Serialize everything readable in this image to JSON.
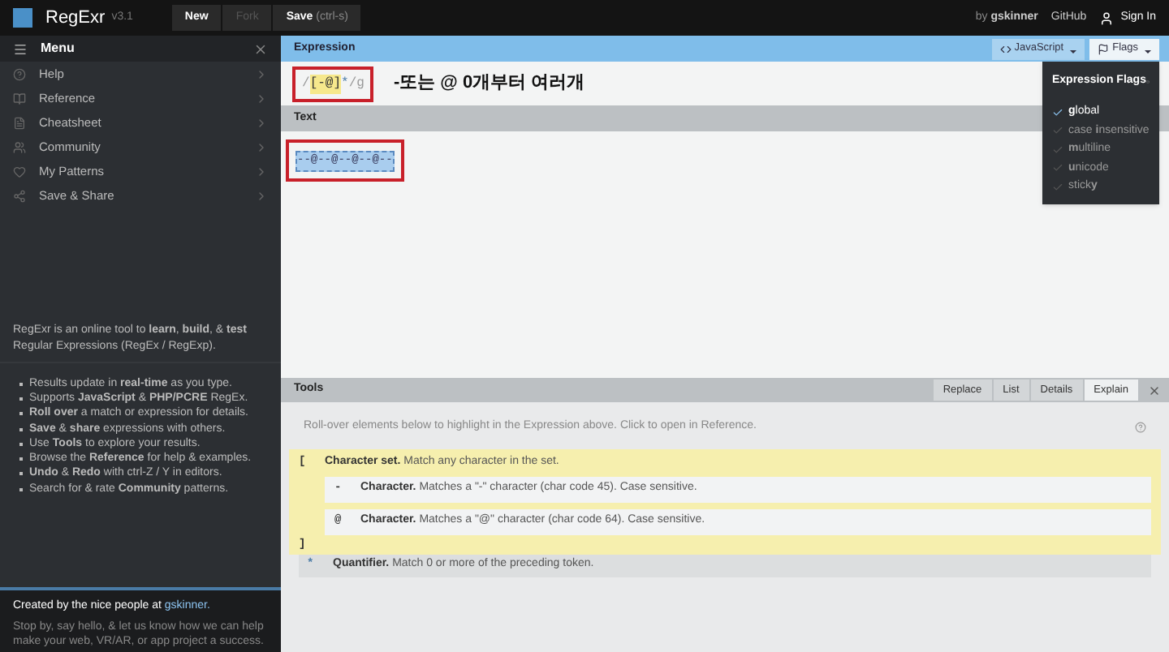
{
  "header": {
    "logo": "RegExr",
    "version": "v3.1",
    "buttons": [
      {
        "label": "New",
        "disabled": false
      },
      {
        "label": "Fork",
        "disabled": true
      },
      {
        "label": "Save",
        "shortcut": "(ctrl-s)",
        "disabled": false
      }
    ],
    "by": "by",
    "author": "gskinner",
    "github": "GitHub",
    "sign_in": "Sign In"
  },
  "sidebar": {
    "title": "Menu",
    "items": [
      {
        "label": "Help"
      },
      {
        "label": "Reference"
      },
      {
        "label": "Cheatsheet"
      },
      {
        "label": "Community"
      },
      {
        "label": "My Patterns"
      },
      {
        "label": "Save & Share"
      }
    ],
    "intro": "RegExr is an online tool to **learn**, **build**, & **test** Regular Expressions (RegEx / RegExp).",
    "features": [
      "Results update in **real-time** as you type.",
      "Supports **JavaScript** & **PHP/PCRE** RegEx.",
      "**Roll over** a match or expression for details.",
      "**Save** & **share** expressions with others.",
      "Use **Tools** to explore your results.",
      "Browse the **Reference** for help & examples.",
      "**Undo** & **Redo** with ctrl-Z / Y in editors.",
      "Search for & rate **Community** patterns."
    ],
    "footer": {
      "lead": "Created by the nice people at",
      "link": "gskinner.",
      "text": "Stop by, say hello, & let us know how we can help make your web, VR/AR, or app project a success."
    }
  },
  "expression": {
    "title": "Expression",
    "flavor": "JavaScript",
    "flags_button": "Flags",
    "open_slash": "/",
    "set": "[-@]",
    "quantifier": "*",
    "close": "/",
    "flags": "g",
    "annotation": "-또는 @ 0개부터 여러개"
  },
  "flags_menu": {
    "title": "Expression Flags",
    "items": [
      {
        "label": "**g**lobal",
        "checked": true
      },
      {
        "label": "case **i**nsensitive",
        "checked": false
      },
      {
        "label": "**m**ultiline",
        "checked": false
      },
      {
        "label": "**u**nicode",
        "checked": false
      },
      {
        "label": "stick**y**",
        "checked": false
      }
    ]
  },
  "text": {
    "title": "Text",
    "value": "--@--@--@--@--"
  },
  "tools": {
    "title": "Tools",
    "tabs": [
      {
        "label": "Replace",
        "selected": false
      },
      {
        "label": "List",
        "selected": false
      },
      {
        "label": "Details",
        "selected": false
      },
      {
        "label": "Explain",
        "selected": true
      }
    ],
    "hint": "Roll-over elements below to highlight in the Expression above. Click to open in Reference.",
    "tokens": [
      {
        "kind": "set",
        "symbol": "[",
        "name": "Character set.",
        "desc": "Match any character in the set.",
        "close": "]",
        "children": [
          {
            "symbol": "-",
            "name": "Character.",
            "desc": "Matches a \"-\" character (char code 45). Case sensitive."
          },
          {
            "symbol": "@",
            "name": "Character.",
            "desc": "Matches a \"@\" character (char code 64). Case sensitive."
          }
        ]
      },
      {
        "kind": "quantifier",
        "symbol": "*",
        "name": "Quantifier.",
        "desc": "Match 0 or more of the preceding token."
      }
    ]
  }
}
